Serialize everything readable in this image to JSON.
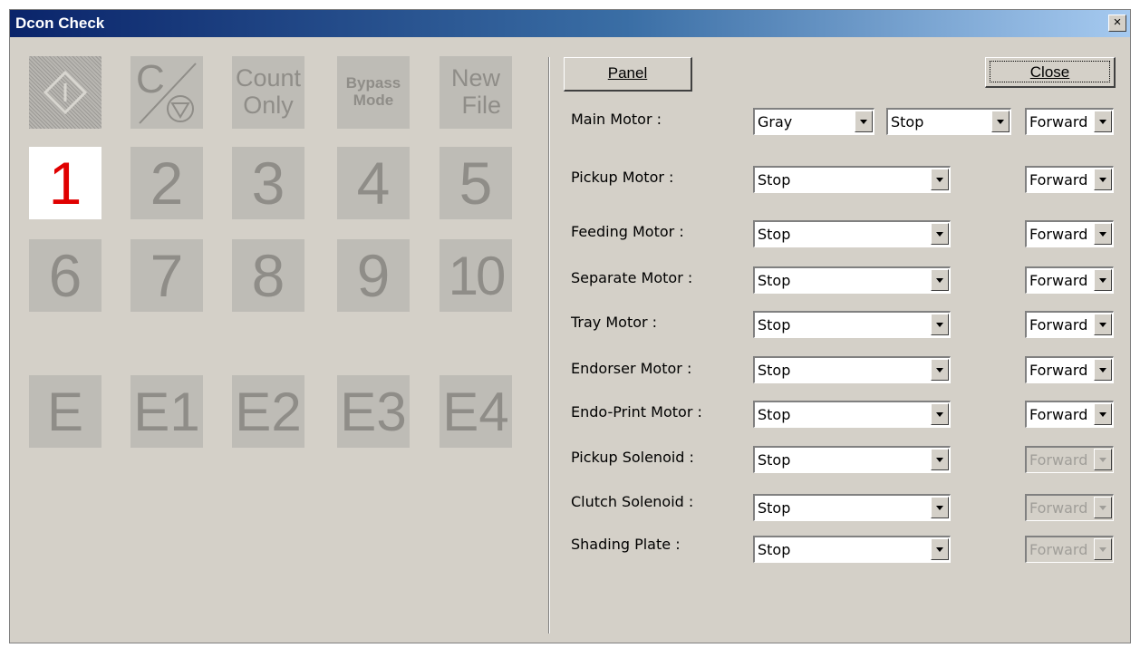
{
  "window": {
    "title": "Dcon Check",
    "close_glyph": "×"
  },
  "tiles": {
    "start_icon": "start-diamond-icon",
    "clear_stop": {
      "letter": "C",
      "icon": "stop-triangle-icon"
    },
    "count_only": [
      "Count",
      "Only"
    ],
    "bypass_mode": [
      "Bypass",
      "Mode"
    ],
    "new_file": [
      "New",
      "File"
    ],
    "numbers": [
      "1",
      "2",
      "3",
      "4",
      "5",
      "6",
      "7",
      "8",
      "9",
      "10"
    ],
    "active_number": "1",
    "errors": [
      "E",
      "E1",
      "E2",
      "E3",
      "E4"
    ]
  },
  "buttons": {
    "panel": "Panel",
    "close": "Close"
  },
  "rows": [
    {
      "label": "Main Motor :",
      "value": "Gray",
      "value2": "Stop",
      "direction": "Forward",
      "direction_enabled": true
    },
    {
      "label": "Pickup Motor :",
      "value": "Stop",
      "direction": "Forward",
      "direction_enabled": true
    },
    {
      "label": "Feeding Motor :",
      "value": "Stop",
      "direction": "Forward",
      "direction_enabled": true
    },
    {
      "label": "Separate Motor :",
      "value": "Stop",
      "direction": "Forward",
      "direction_enabled": true
    },
    {
      "label": "Tray Motor :",
      "value": "Stop",
      "direction": "Forward",
      "direction_enabled": true
    },
    {
      "label": "Endorser Motor :",
      "value": "Stop",
      "direction": "Forward",
      "direction_enabled": true
    },
    {
      "label": "Endo-Print Motor :",
      "value": "Stop",
      "direction": "Forward",
      "direction_enabled": true
    },
    {
      "label": "Pickup Solenoid :",
      "value": "Stop",
      "direction": "Forward",
      "direction_enabled": false
    },
    {
      "label": "Clutch Solenoid :",
      "value": "Stop",
      "direction": "Forward",
      "direction_enabled": false
    },
    {
      "label": "Shading Plate :",
      "value": "Stop",
      "direction": "Forward",
      "direction_enabled": false
    }
  ]
}
